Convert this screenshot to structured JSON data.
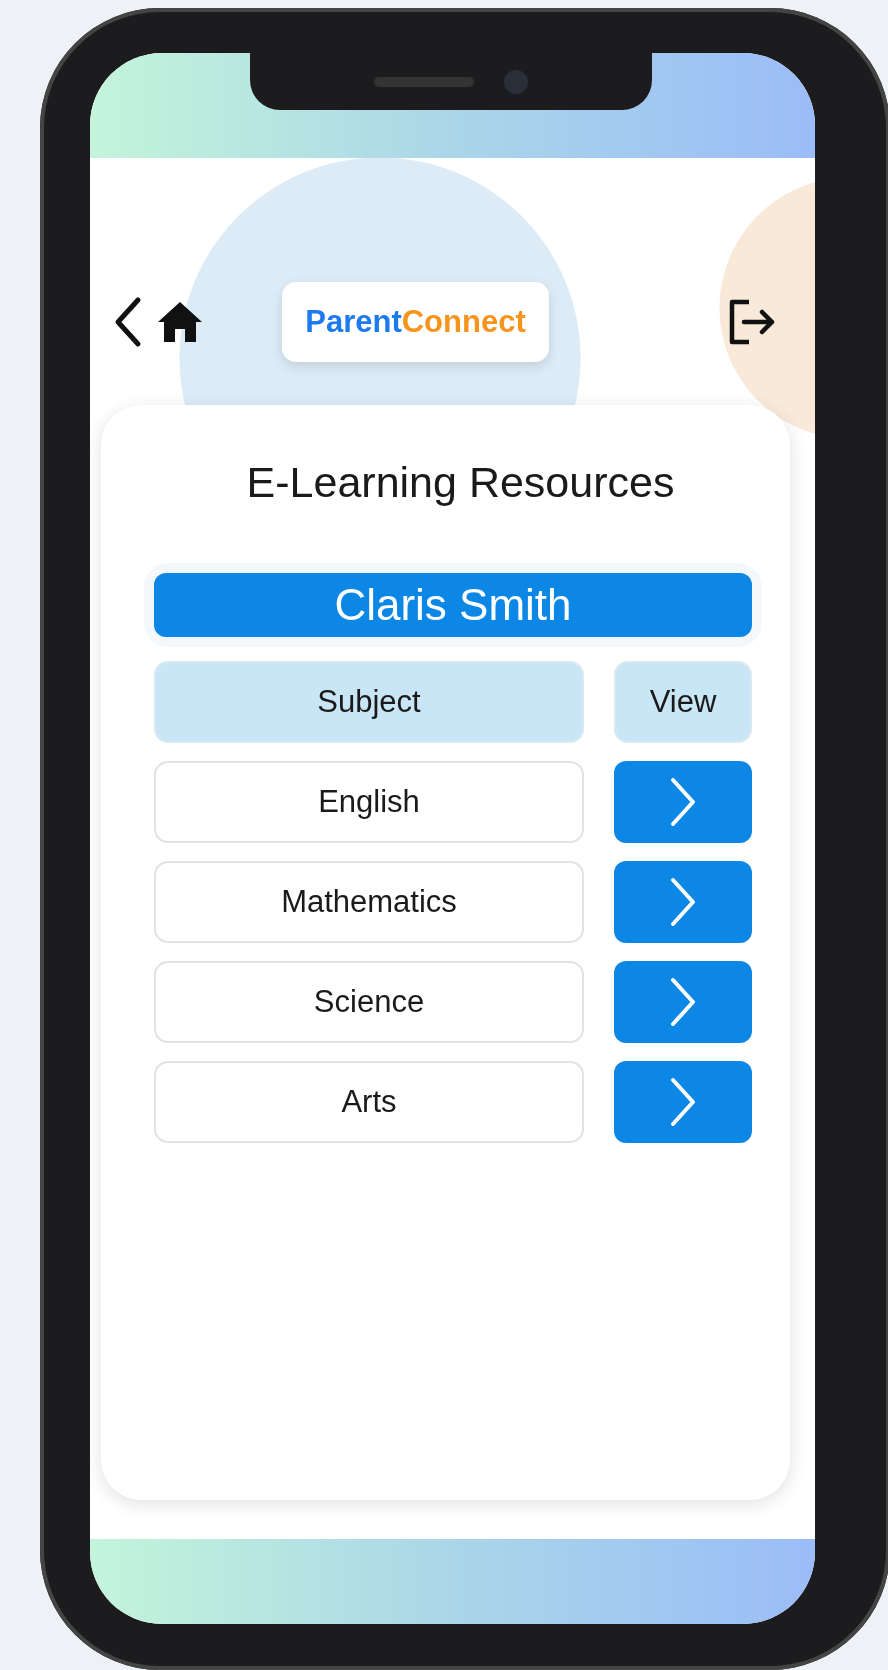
{
  "header": {
    "logo": {
      "first": "Parent",
      "second": "Connect"
    }
  },
  "page_title": "E-Learning Resources",
  "student_name": "Claris Smith",
  "table": {
    "columns": [
      "Subject",
      "View"
    ],
    "rows": [
      {
        "subject": "English"
      },
      {
        "subject": "Mathematics"
      },
      {
        "subject": "Science"
      },
      {
        "subject": "Arts"
      }
    ]
  }
}
